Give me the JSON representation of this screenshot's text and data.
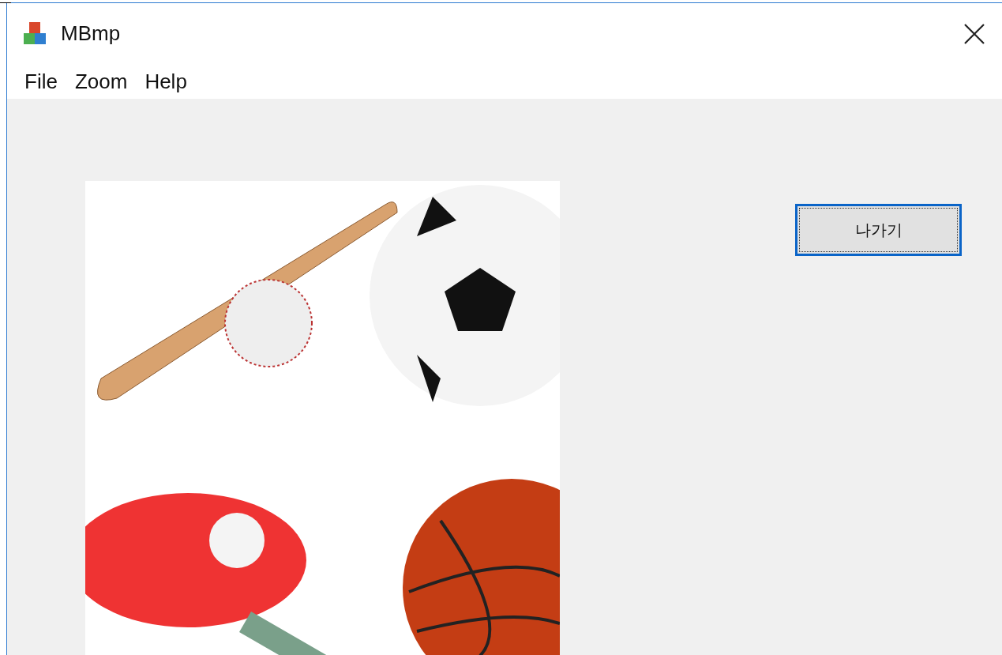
{
  "window": {
    "title": "MBmp"
  },
  "menu": [
    {
      "label": "File"
    },
    {
      "label": "Zoom"
    },
    {
      "label": "Help"
    }
  ],
  "exit_button": {
    "label": "나가기",
    "focused": true
  }
}
